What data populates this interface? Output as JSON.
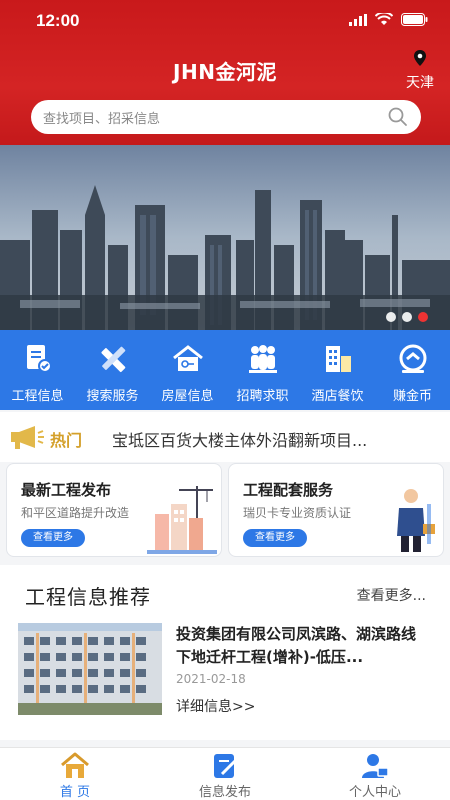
{
  "status_bar": {
    "time": "12:00"
  },
  "header": {
    "title": "JHN金河泥",
    "location": "天津",
    "search_placeholder": "查找项目、招采信息"
  },
  "banner": {
    "slide_count": 3,
    "active_index": 2
  },
  "categories": [
    {
      "label": "工程信息",
      "icon": "document-edit-icon"
    },
    {
      "label": "搜索服务",
      "icon": "pencil-ruler-icon"
    },
    {
      "label": "房屋信息",
      "icon": "house-icon"
    },
    {
      "label": "招聘求职",
      "icon": "people-icon"
    },
    {
      "label": "酒店餐饮",
      "icon": "building-icon"
    },
    {
      "label": "赚金币",
      "icon": "coin-icon"
    }
  ],
  "hot": {
    "label": "热门",
    "text": "宝坻区百货大楼主体外沿翻新项目..."
  },
  "cards": [
    {
      "title": "最新工程发布",
      "subtitle": "和平区道路提升改造",
      "button": "查看更多"
    },
    {
      "title": "工程配套服务",
      "subtitle": "瑞贝卡专业资质认证",
      "button": "查看更多"
    }
  ],
  "recommend": {
    "title": "工程信息推荐",
    "more": "查看更多...",
    "item": {
      "headline": "投资集团有限公司凤滨路、湖滨路线下地迁杆工程(增补)-低压...",
      "date": "2021-02-18",
      "detail": "详细信息>>"
    }
  },
  "tabbar": [
    {
      "label": "首  页",
      "icon": "home-icon",
      "active": true
    },
    {
      "label": "信息发布",
      "icon": "publish-icon",
      "active": false
    },
    {
      "label": "个人中心",
      "icon": "user-icon",
      "active": false
    }
  ],
  "colors": {
    "brand_red": "#c9191b",
    "accent_blue": "#2d78e6",
    "hot_gold": "#d4a02a"
  }
}
